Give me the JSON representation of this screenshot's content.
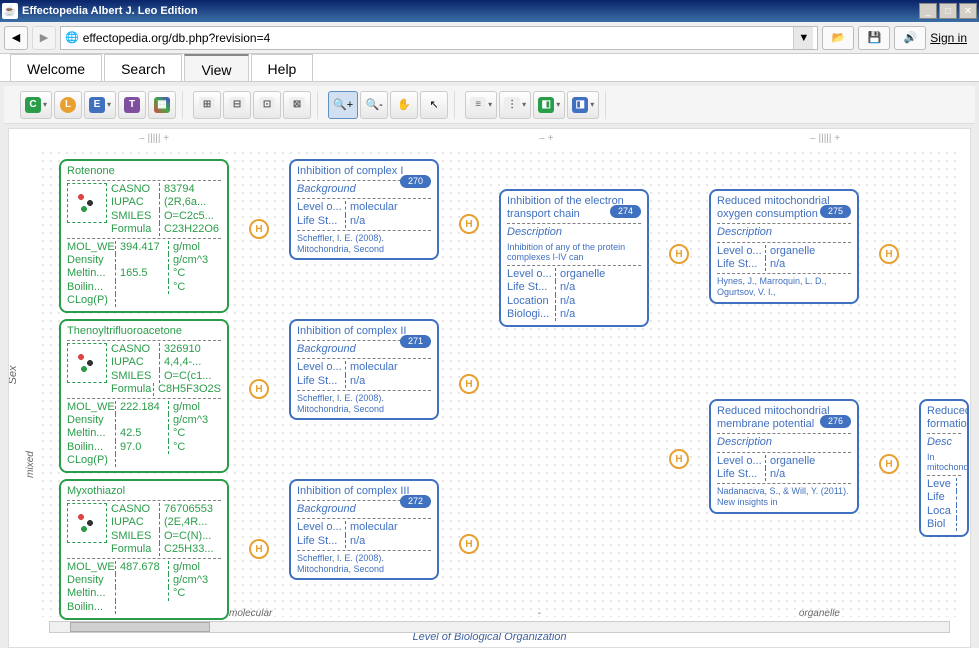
{
  "window": {
    "title": "Effectopedia  Albert J. Leo Edition"
  },
  "nav": {
    "url": "effectopedia.org/db.php?revision=4",
    "signin": "Sign in"
  },
  "tabs": [
    "Welcome",
    "Search",
    "View",
    "Help"
  ],
  "active_tab": 2,
  "axes": {
    "y_label": "Sex",
    "y_sub": "mixed",
    "x_label": "Level of Biological Organization",
    "x_sub_left": "molecular",
    "x_sub_right": "organelle"
  },
  "chemicals": [
    {
      "name": "Rotenone",
      "props": [
        [
          "CASNO",
          "83794"
        ],
        [
          "IUPAC",
          "(2R,6a..."
        ],
        [
          "SMILES",
          "O=C2c5..."
        ],
        [
          "Formula",
          "C23H22O6"
        ]
      ],
      "phys": [
        [
          "MOL_WE...",
          "394.417",
          "g/mol"
        ],
        [
          "Density",
          "",
          "g/cm^3"
        ],
        [
          "Meltin...",
          "165.5",
          "°C"
        ],
        [
          "Boilin...",
          "",
          "°C"
        ],
        [
          "CLog(P)",
          "",
          ""
        ]
      ]
    },
    {
      "name": "Thenoyltrifluoroacetone",
      "props": [
        [
          "CASNO",
          "326910"
        ],
        [
          "IUPAC",
          "4,4,4-..."
        ],
        [
          "SMILES",
          "O=C(c1..."
        ],
        [
          "Formula",
          "C8H5F3O2S"
        ]
      ],
      "phys": [
        [
          "MOL_WE...",
          "222.184",
          "g/mol"
        ],
        [
          "Density",
          "",
          "g/cm^3"
        ],
        [
          "Meltin...",
          "42.5",
          "°C"
        ],
        [
          "Boilin...",
          "97.0",
          "°C"
        ],
        [
          "CLog(P)",
          "",
          ""
        ]
      ]
    },
    {
      "name": "Myxothiazol",
      "props": [
        [
          "CASNO",
          "76706553"
        ],
        [
          "IUPAC",
          "(2E,4R..."
        ],
        [
          "SMILES",
          "O=C(N)..."
        ],
        [
          "Formula",
          "C25H33..."
        ]
      ],
      "phys": [
        [
          "MOL_WE...",
          "487.678",
          "g/mol"
        ],
        [
          "Density",
          "",
          "g/cm^3"
        ],
        [
          "Meltin...",
          "",
          "°C"
        ],
        [
          "Boilin...",
          "",
          ""
        ]
      ]
    }
  ],
  "effects_col1": [
    {
      "title": "Inhibition of complex I",
      "id": "270",
      "section": "Background",
      "rows": [
        [
          "Level o...",
          "molecular"
        ],
        [
          "Life St...",
          "n/a"
        ]
      ],
      "ref": "Scheffler, I. E. (2008). Mitochondria, Second"
    },
    {
      "title": "Inhibition of complex II",
      "id": "271",
      "section": "Background",
      "rows": [
        [
          "Level o...",
          "molecular"
        ],
        [
          "Life St...",
          "n/a"
        ]
      ],
      "ref": "Scheffler, I. E. (2008). Mitochondria, Second"
    },
    {
      "title": "Inhibition of complex III",
      "id": "272",
      "section": "Background",
      "rows": [
        [
          "Level o...",
          "molecular"
        ],
        [
          "Life St...",
          "n/a"
        ]
      ],
      "ref": "Scheffler, I. E. (2008). Mitochondria, Second"
    }
  ],
  "effects_col2": [
    {
      "title": "Inhibition of the electron transport chain",
      "id": "274",
      "section": "Description",
      "desc": "Inhibition of any of the protein complexes I-IV can",
      "rows": [
        [
          "Level o...",
          "organelle"
        ],
        [
          "Life St...",
          "n/a"
        ],
        [
          "Location",
          "n/a"
        ],
        [
          "Biologi...",
          "n/a"
        ]
      ]
    }
  ],
  "effects_col3": [
    {
      "title": "Reduced mitochondrial oxygen consumption",
      "id": "275",
      "section": "Description",
      "rows": [
        [
          "Level o...",
          "organelle"
        ],
        [
          "Life St...",
          "n/a"
        ]
      ],
      "ref": "Hynes, J., Marroquin, L. D., Ogurtsov, V. I.,"
    },
    {
      "title": "Reduced mitochondrial membrane potential",
      "id": "276",
      "section": "Description",
      "rows": [
        [
          "Level o...",
          "organelle"
        ],
        [
          "Life St...",
          "n/a"
        ]
      ],
      "ref": "Nadanaciva, S., & Will, Y. (2011). New insights in"
    }
  ],
  "partial": {
    "title": "Reduced formation",
    "section": "Desc",
    "desc": "In mitochondria",
    "rows": [
      [
        "Leve",
        ""
      ],
      [
        "Life",
        ""
      ],
      [
        "Loca",
        ""
      ],
      [
        "Biol",
        ""
      ]
    ]
  }
}
